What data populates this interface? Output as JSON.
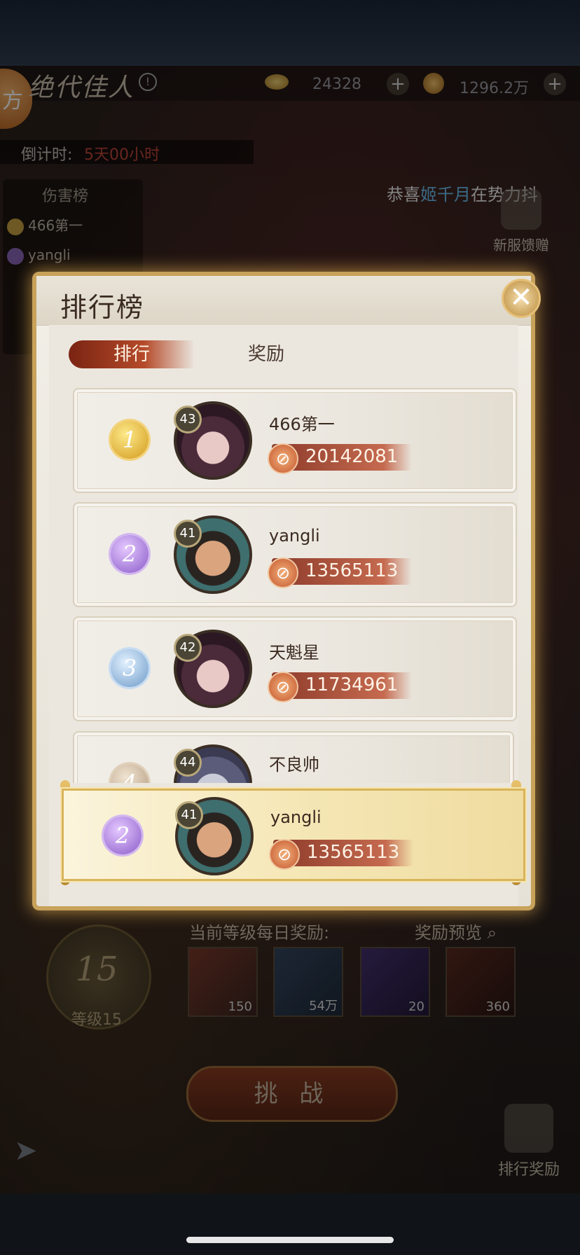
{
  "hud": {
    "logo_char": "方",
    "event_title": "绝代佳人",
    "info_symbol": "!",
    "gold_value": "24328",
    "coin_value": "1296.2万",
    "plus_symbol": "+"
  },
  "countdown": {
    "label": "倒计时:",
    "value": "5天00小时"
  },
  "damage_board": {
    "title": "伤害榜",
    "entries": [
      {
        "name": "466第一"
      },
      {
        "name": "yangli"
      }
    ]
  },
  "marquee": {
    "prefix": "恭喜",
    "highlight": "姬千月",
    "suffix": "在势力抖"
  },
  "side_buttons": {
    "new_server_gift": "新服馈赠",
    "rank_reward": "排行奖励"
  },
  "modal": {
    "title": "排行榜",
    "close_symbol": "✕",
    "tabs": [
      {
        "label": "排行",
        "active": true
      },
      {
        "label": "奖励",
        "active": false
      }
    ]
  },
  "ranking": [
    {
      "rank": "1",
      "level": "43",
      "name": "466第一",
      "power": "20142081",
      "badge": "gold",
      "avatar": "female"
    },
    {
      "rank": "2",
      "level": "41",
      "name": "yangli",
      "power": "13565113",
      "badge": "purple",
      "avatar": "male"
    },
    {
      "rank": "3",
      "level": "42",
      "name": "天魁星",
      "power": "11734961",
      "badge": "blue",
      "avatar": "female"
    },
    {
      "rank": "4",
      "level": "44",
      "name": "不良帅",
      "power": "",
      "badge": "grey",
      "avatar": "silver"
    }
  ],
  "my_rank": {
    "rank": "2",
    "level": "41",
    "name": "yangli",
    "power": "13565113"
  },
  "level_panel": {
    "level": "15",
    "label": "等级15"
  },
  "daily_reward": {
    "title": "当前等级每日奖励:",
    "preview_label": "奖励预览",
    "items": [
      {
        "icon": "sword-icon",
        "count": "150"
      },
      {
        "icon": "jade-icon",
        "count": "54万"
      },
      {
        "icon": "scroll-icon",
        "count": "20"
      },
      {
        "icon": "orb-icon",
        "count": "360"
      }
    ]
  },
  "challenge_label": "挑 战",
  "power_icon_symbol": "⊘",
  "colors": {
    "gold_border": "#c8a25a",
    "tab_active": "#b54a2a",
    "highlight_name": "#6cc0f0"
  }
}
